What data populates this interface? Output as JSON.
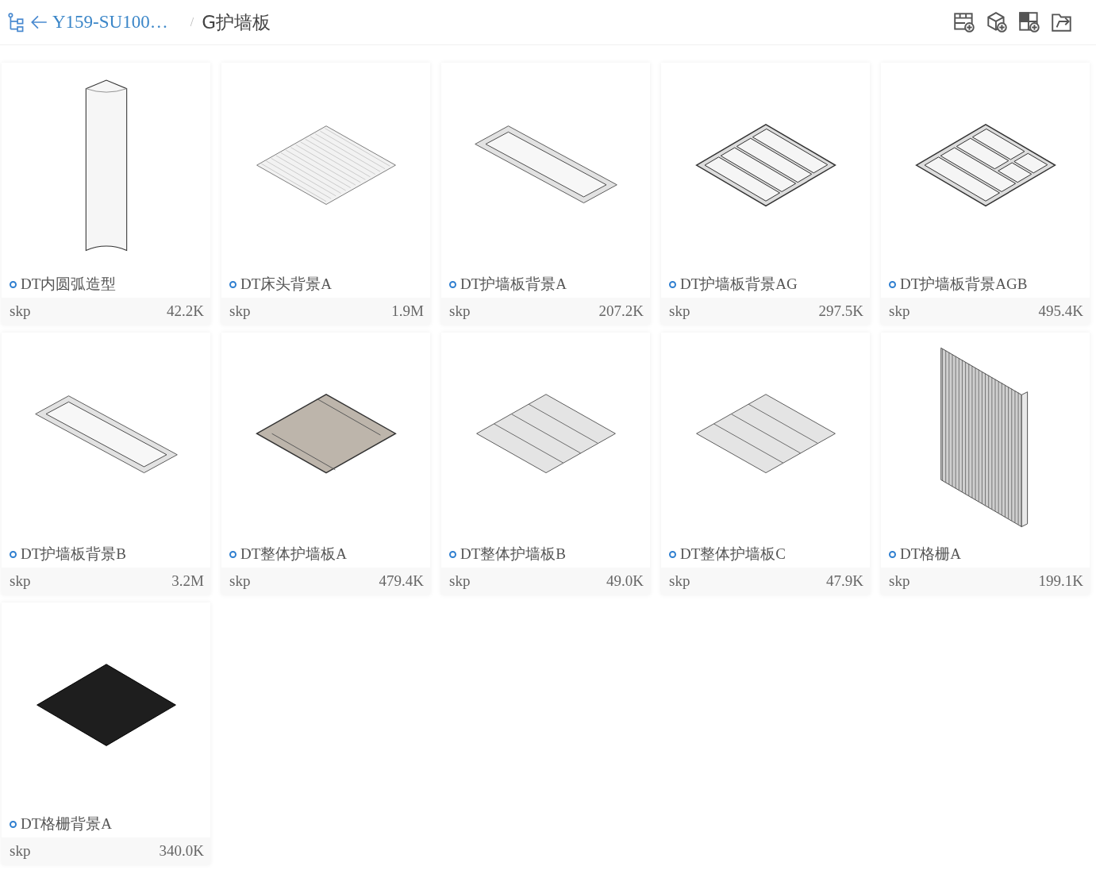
{
  "breadcrumb": {
    "parent": "Y159-SU100…",
    "separator": "/",
    "current": "G护墙板"
  },
  "files": [
    {
      "name": "DT内圆弧造型",
      "type": "skp",
      "size": "42.2K",
      "kind": "column"
    },
    {
      "name": "DT床头背景A",
      "type": "skp",
      "size": "1.9M",
      "kind": "slats"
    },
    {
      "name": "DT护墙板背景A",
      "type": "skp",
      "size": "207.2K",
      "kind": "framed"
    },
    {
      "name": "DT护墙板背景AG",
      "type": "skp",
      "size": "297.5K",
      "kind": "grid"
    },
    {
      "name": "DT护墙板背景AGB",
      "type": "skp",
      "size": "495.4K",
      "kind": "mixed"
    },
    {
      "name": "DT护墙板背景B",
      "type": "skp",
      "size": "3.2M",
      "kind": "framed"
    },
    {
      "name": "DT整体护墙板A",
      "type": "skp",
      "size": "479.4K",
      "kind": "tan"
    },
    {
      "name": "DT整体护墙板B",
      "type": "skp",
      "size": "49.0K",
      "kind": "striped"
    },
    {
      "name": "DT整体护墙板C",
      "type": "skp",
      "size": "47.9K",
      "kind": "striped"
    },
    {
      "name": "DT格栅A",
      "type": "skp",
      "size": "199.1K",
      "kind": "grille"
    },
    {
      "name": "DT格栅背景A",
      "type": "skp",
      "size": "340.0K",
      "kind": "dark"
    }
  ]
}
